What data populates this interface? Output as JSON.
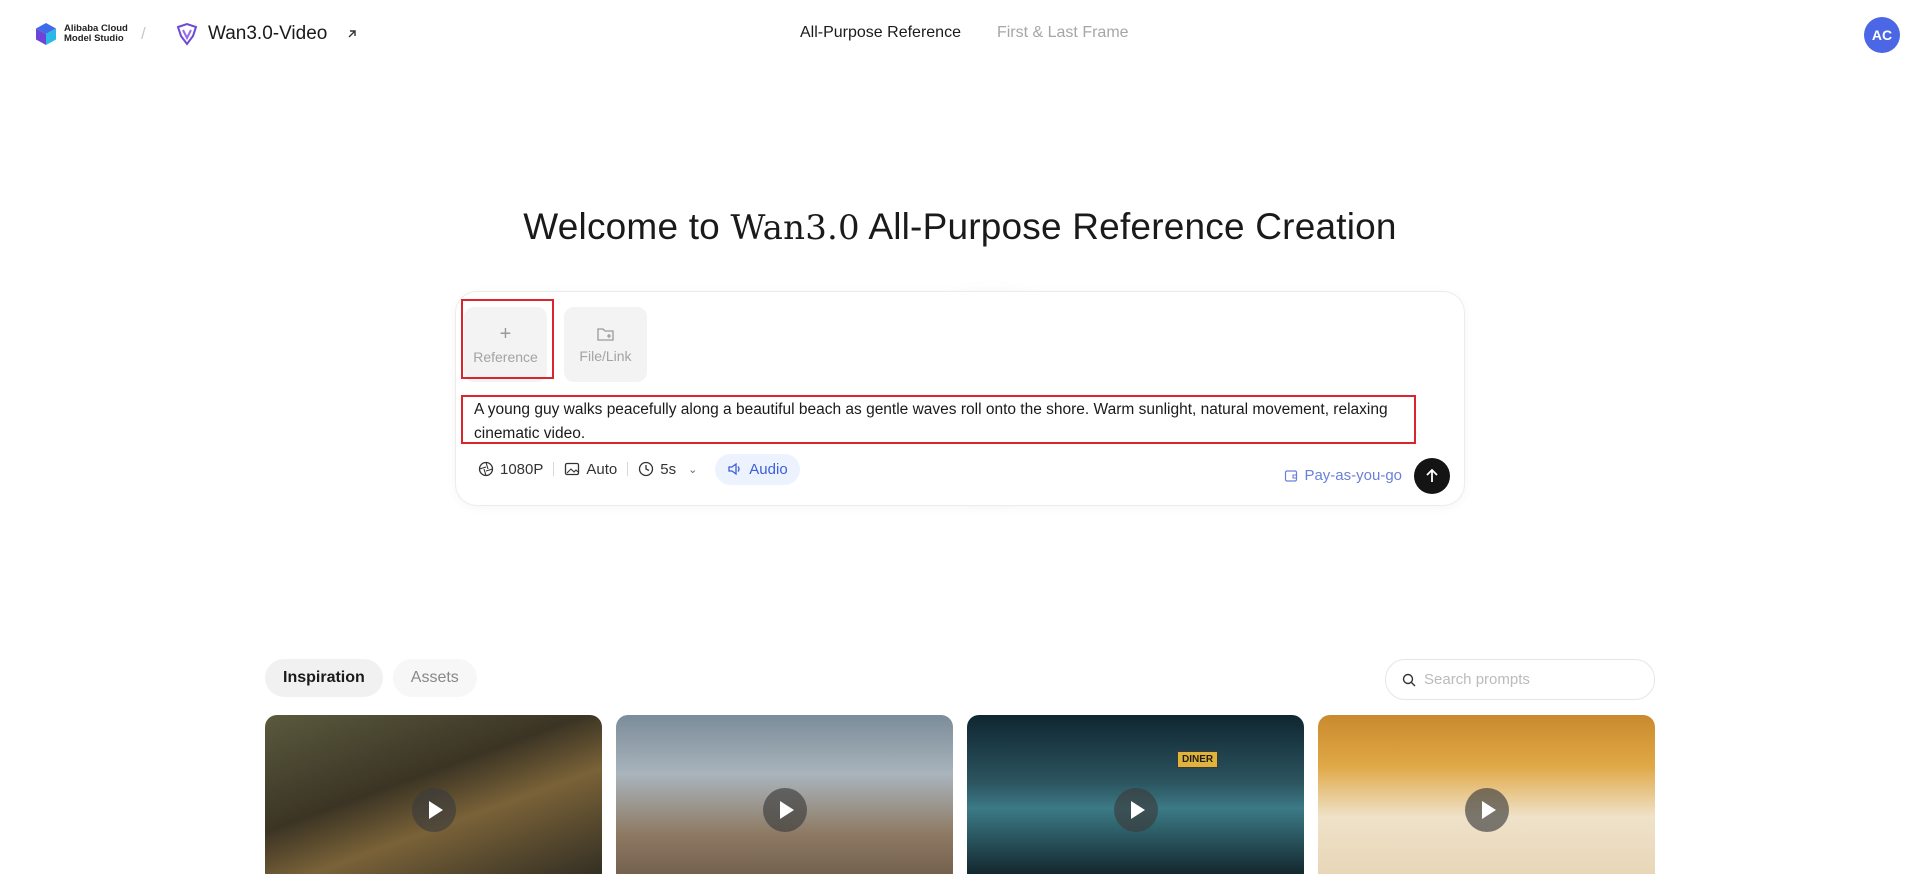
{
  "header": {
    "brand_label": "Alibaba Cloud\nModel Studio",
    "separator": "/",
    "product_name": "Wan3.0-Video",
    "mode_tabs": [
      {
        "label": "All-Purpose Reference",
        "active": true
      },
      {
        "label": "First & Last Frame",
        "active": false
      }
    ],
    "avatar_initials": "AC"
  },
  "hero": {
    "title_prefix": "Welcome to ",
    "title_model": "Wan3.0",
    "title_suffix": " All-Purpose Reference Creation"
  },
  "prompt_card": {
    "reference_tile": {
      "icon": "plus-icon",
      "label": "Reference"
    },
    "file_tile": {
      "icon": "folder-add-icon",
      "label": "File/Link"
    },
    "prompt_text": "A young guy walks peacefully along a beautiful beach as gentle waves roll onto the shore. Warm sunlight, natural movement, relaxing cinematic video.",
    "controls": {
      "resolution": "1080P",
      "aspect": "Auto",
      "duration": "5s",
      "audio": "Audio"
    },
    "billing": "Pay-as-you-go",
    "send_icon": "arrow-up-icon"
  },
  "lower": {
    "tabs": [
      {
        "label": "Inspiration",
        "active": true
      },
      {
        "label": "Assets",
        "active": false
      }
    ],
    "search_placeholder": "Search prompts",
    "thumb_sign": "DINER"
  },
  "colors": {
    "accent_blue": "#3d5ed8",
    "avatar_bg": "#4c67e6",
    "highlight_red": "#d9262c",
    "send_bg": "#141414"
  }
}
